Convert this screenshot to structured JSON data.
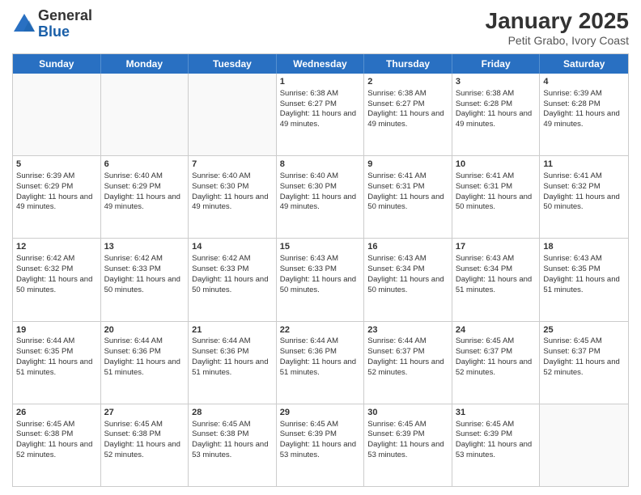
{
  "header": {
    "logo_line1": "General",
    "logo_line2": "Blue",
    "title": "January 2025",
    "subtitle": "Petit Grabo, Ivory Coast"
  },
  "weekdays": [
    "Sunday",
    "Monday",
    "Tuesday",
    "Wednesday",
    "Thursday",
    "Friday",
    "Saturday"
  ],
  "weeks": [
    [
      {
        "day": "",
        "info": "",
        "empty": true
      },
      {
        "day": "",
        "info": "",
        "empty": true
      },
      {
        "day": "",
        "info": "",
        "empty": true
      },
      {
        "day": "1",
        "info": "Sunrise: 6:38 AM\nSunset: 6:27 PM\nDaylight: 11 hours and 49 minutes."
      },
      {
        "day": "2",
        "info": "Sunrise: 6:38 AM\nSunset: 6:27 PM\nDaylight: 11 hours and 49 minutes."
      },
      {
        "day": "3",
        "info": "Sunrise: 6:38 AM\nSunset: 6:28 PM\nDaylight: 11 hours and 49 minutes."
      },
      {
        "day": "4",
        "info": "Sunrise: 6:39 AM\nSunset: 6:28 PM\nDaylight: 11 hours and 49 minutes."
      }
    ],
    [
      {
        "day": "5",
        "info": "Sunrise: 6:39 AM\nSunset: 6:29 PM\nDaylight: 11 hours and 49 minutes."
      },
      {
        "day": "6",
        "info": "Sunrise: 6:40 AM\nSunset: 6:29 PM\nDaylight: 11 hours and 49 minutes."
      },
      {
        "day": "7",
        "info": "Sunrise: 6:40 AM\nSunset: 6:30 PM\nDaylight: 11 hours and 49 minutes."
      },
      {
        "day": "8",
        "info": "Sunrise: 6:40 AM\nSunset: 6:30 PM\nDaylight: 11 hours and 49 minutes."
      },
      {
        "day": "9",
        "info": "Sunrise: 6:41 AM\nSunset: 6:31 PM\nDaylight: 11 hours and 50 minutes."
      },
      {
        "day": "10",
        "info": "Sunrise: 6:41 AM\nSunset: 6:31 PM\nDaylight: 11 hours and 50 minutes."
      },
      {
        "day": "11",
        "info": "Sunrise: 6:41 AM\nSunset: 6:32 PM\nDaylight: 11 hours and 50 minutes."
      }
    ],
    [
      {
        "day": "12",
        "info": "Sunrise: 6:42 AM\nSunset: 6:32 PM\nDaylight: 11 hours and 50 minutes."
      },
      {
        "day": "13",
        "info": "Sunrise: 6:42 AM\nSunset: 6:33 PM\nDaylight: 11 hours and 50 minutes."
      },
      {
        "day": "14",
        "info": "Sunrise: 6:42 AM\nSunset: 6:33 PM\nDaylight: 11 hours and 50 minutes."
      },
      {
        "day": "15",
        "info": "Sunrise: 6:43 AM\nSunset: 6:33 PM\nDaylight: 11 hours and 50 minutes."
      },
      {
        "day": "16",
        "info": "Sunrise: 6:43 AM\nSunset: 6:34 PM\nDaylight: 11 hours and 50 minutes."
      },
      {
        "day": "17",
        "info": "Sunrise: 6:43 AM\nSunset: 6:34 PM\nDaylight: 11 hours and 51 minutes."
      },
      {
        "day": "18",
        "info": "Sunrise: 6:43 AM\nSunset: 6:35 PM\nDaylight: 11 hours and 51 minutes."
      }
    ],
    [
      {
        "day": "19",
        "info": "Sunrise: 6:44 AM\nSunset: 6:35 PM\nDaylight: 11 hours and 51 minutes."
      },
      {
        "day": "20",
        "info": "Sunrise: 6:44 AM\nSunset: 6:36 PM\nDaylight: 11 hours and 51 minutes."
      },
      {
        "day": "21",
        "info": "Sunrise: 6:44 AM\nSunset: 6:36 PM\nDaylight: 11 hours and 51 minutes."
      },
      {
        "day": "22",
        "info": "Sunrise: 6:44 AM\nSunset: 6:36 PM\nDaylight: 11 hours and 51 minutes."
      },
      {
        "day": "23",
        "info": "Sunrise: 6:44 AM\nSunset: 6:37 PM\nDaylight: 11 hours and 52 minutes."
      },
      {
        "day": "24",
        "info": "Sunrise: 6:45 AM\nSunset: 6:37 PM\nDaylight: 11 hours and 52 minutes."
      },
      {
        "day": "25",
        "info": "Sunrise: 6:45 AM\nSunset: 6:37 PM\nDaylight: 11 hours and 52 minutes."
      }
    ],
    [
      {
        "day": "26",
        "info": "Sunrise: 6:45 AM\nSunset: 6:38 PM\nDaylight: 11 hours and 52 minutes."
      },
      {
        "day": "27",
        "info": "Sunrise: 6:45 AM\nSunset: 6:38 PM\nDaylight: 11 hours and 52 minutes."
      },
      {
        "day": "28",
        "info": "Sunrise: 6:45 AM\nSunset: 6:38 PM\nDaylight: 11 hours and 53 minutes."
      },
      {
        "day": "29",
        "info": "Sunrise: 6:45 AM\nSunset: 6:39 PM\nDaylight: 11 hours and 53 minutes."
      },
      {
        "day": "30",
        "info": "Sunrise: 6:45 AM\nSunset: 6:39 PM\nDaylight: 11 hours and 53 minutes."
      },
      {
        "day": "31",
        "info": "Sunrise: 6:45 AM\nSunset: 6:39 PM\nDaylight: 11 hours and 53 minutes."
      },
      {
        "day": "",
        "info": "",
        "empty": true
      }
    ]
  ]
}
